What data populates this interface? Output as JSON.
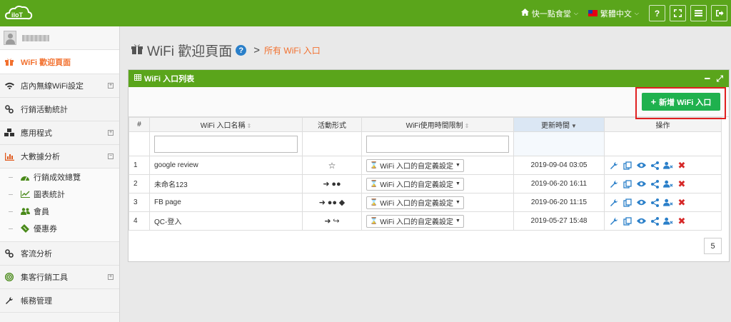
{
  "header": {
    "store": "快一點食堂",
    "language": "繁體中文",
    "buttons": [
      "help-icon",
      "fullscreen-icon",
      "menu-icon",
      "logout-icon"
    ]
  },
  "sidebar": {
    "items": [
      {
        "label": "WiFi 歡迎頁面",
        "icon": "gift-icon",
        "active": true
      },
      {
        "label": "店內無線WiFi設定",
        "icon": "wifi-icon",
        "expand": "+"
      },
      {
        "label": "行銷活動統計",
        "icon": "link-icon"
      },
      {
        "label": "應用程式",
        "icon": "cubes-icon",
        "expand": "+"
      },
      {
        "label": "大數據分析",
        "icon": "bar-chart-icon",
        "expand": "−"
      }
    ],
    "sub_items": [
      {
        "label": "行銷成效總覽",
        "icon": "dashboard-icon"
      },
      {
        "label": "圖表統計",
        "icon": "line-chart-icon"
      },
      {
        "label": "會員",
        "icon": "users-icon"
      },
      {
        "label": "優惠券",
        "icon": "ticket-icon"
      }
    ],
    "more_items": [
      {
        "label": "客流分析",
        "icon": "link-icon"
      },
      {
        "label": "集客行銷工具",
        "icon": "bullseye-icon",
        "expand": "+"
      },
      {
        "label": "帳務管理",
        "icon": "wrench-icon"
      }
    ]
  },
  "page": {
    "title": "WiFi 歡迎頁面",
    "breadcrumb_sep": ">",
    "breadcrumb": "所有 WiFi 入口"
  },
  "panel": {
    "title": "WiFi 入口列表",
    "add_button": "新增 WiFi 入口"
  },
  "table": {
    "headers": [
      "#",
      "WiFi 入口名稱",
      "活動形式",
      "WiFi使用時間限制",
      "更新時間",
      "操作"
    ],
    "rows": [
      {
        "num": "1",
        "name": "google review",
        "limit": "WiFi 入口的自定義設定",
        "updated": "2019-09-04 03:05"
      },
      {
        "num": "2",
        "name": "未命名123",
        "limit": "WiFi 入口的自定義設定",
        "updated": "2019-06-20 16:11"
      },
      {
        "num": "3",
        "name": "FB page",
        "limit": "WiFi 入口的自定義設定",
        "updated": "2019-06-20 11:15"
      },
      {
        "num": "4",
        "name": "QC-登入",
        "limit": "WiFi 入口的自定義設定",
        "updated": "2019-05-27 15:48"
      }
    ]
  },
  "pagination": {
    "page_size": "5"
  },
  "colors": {
    "brand_green": "#5aa51b",
    "accent_orange": "#f2712f",
    "button_green": "#1fb14e",
    "action_blue": "#2a7fc9",
    "delete_red": "#d62828"
  }
}
